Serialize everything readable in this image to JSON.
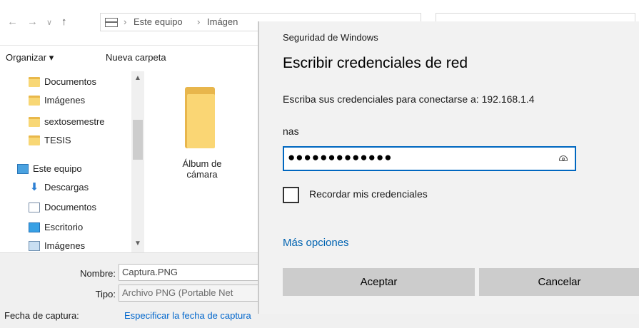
{
  "explorer": {
    "breadcrumb": [
      "Este equipo",
      "Imágen"
    ],
    "crumb_sep": "›",
    "toolbar": {
      "organize": "Organizar ▾",
      "new_folder": "Nueva carpeta"
    },
    "nav_items": [
      {
        "label": "Documentos",
        "icon": "folder-icon"
      },
      {
        "label": "Imágenes",
        "icon": "folder-icon"
      },
      {
        "label": "sextosemestre",
        "icon": "folder-icon"
      },
      {
        "label": "TESIS",
        "icon": "folder-icon"
      },
      {
        "label": "Este equipo",
        "icon": "pc-icon"
      },
      {
        "label": "Descargas",
        "icon": "download-icon"
      },
      {
        "label": "Documentos",
        "icon": "document-icon"
      },
      {
        "label": "Escritorio",
        "icon": "desktop-icon"
      },
      {
        "label": "Imágenes",
        "icon": "pictures-icon"
      }
    ],
    "folder_item": {
      "label_line1": "Álbum de",
      "label_line2": "cámara"
    },
    "fields": {
      "name_label": "Nombre:",
      "name_value": "Captura.PNG",
      "type_label": "Tipo:",
      "type_value": "Archivo PNG (Portable Net",
      "date_label": "Fecha de captura:",
      "date_link": "Especificar la fecha de captura"
    }
  },
  "dialog": {
    "caption": "Seguridad de Windows",
    "title": "Escribir credenciales de red",
    "description": "Escriba sus credenciales para conectarse a: 192.168.1.4",
    "username": "nas",
    "password_mask": "●●●●●●●●●●●●●",
    "remember_label": "Recordar mis credenciales",
    "remember_checked": false,
    "more_options": "Más opciones",
    "ok_label": "Aceptar",
    "cancel_label": "Cancelar",
    "accent_color": "#0067c0"
  }
}
